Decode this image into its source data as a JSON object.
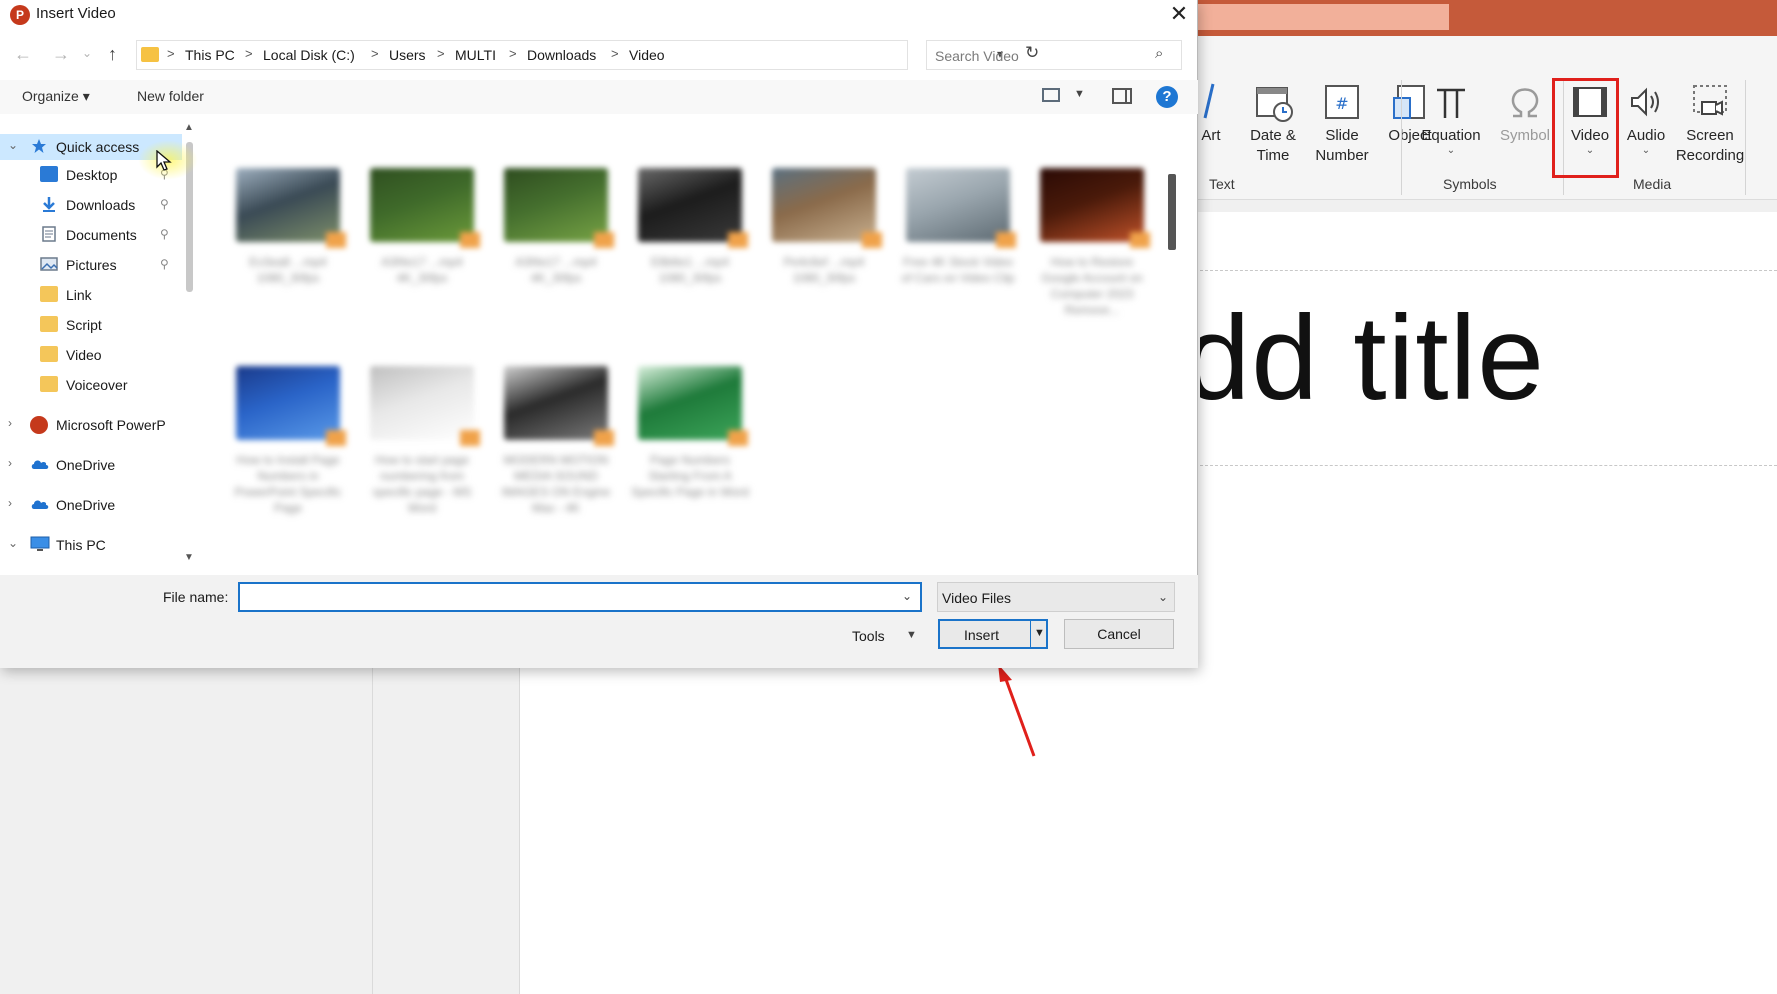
{
  "dialog": {
    "title": "Insert Video",
    "app_icon_letter": "P",
    "close_glyph": "✕"
  },
  "nav": {
    "back_glyph": "←",
    "forward_glyph": "→",
    "recent_glyph": "⌄",
    "up_glyph": "↑",
    "breadcrumb": [
      "This PC",
      "Local Disk (C:)",
      "Users",
      "MULTI",
      "Downloads",
      "Video"
    ],
    "crumb_sep": ">",
    "refresh_glyph": "↻",
    "search_placeholder": "Search Video",
    "search_glyph": "⌕"
  },
  "toolbar": {
    "organize_label": "Organize ▾",
    "new_folder_label": "New folder",
    "help_glyph": "?",
    "view_dd_glyph": "▼"
  },
  "sidebar": {
    "items": [
      {
        "label": "Quick access",
        "icon": "star-icon"
      },
      {
        "label": "Desktop",
        "icon": "desktop-icon"
      },
      {
        "label": "Downloads",
        "icon": "download-icon"
      },
      {
        "label": "Documents",
        "icon": "document-icon"
      },
      {
        "label": "Pictures",
        "icon": "pictures-icon"
      },
      {
        "label": "Link",
        "icon": "folder-icon"
      },
      {
        "label": "Script",
        "icon": "folder-icon"
      },
      {
        "label": "Video",
        "icon": "folder-icon"
      },
      {
        "label": "Voiceover",
        "icon": "folder-icon"
      },
      {
        "label": "Microsoft PowerP",
        "icon": "powerpoint-icon"
      },
      {
        "label": "OneDrive",
        "icon": "cloud-icon"
      },
      {
        "label": "OneDrive",
        "icon": "cloud-icon"
      },
      {
        "label": "This PC",
        "icon": "computer-icon"
      }
    ],
    "pin_glyph": "📌",
    "expand_glyph": "›",
    "collapse_glyph": "⌄"
  },
  "files": [
    {
      "caption": "Ev3ea8 ...mp4 1080_30fps",
      "colors": [
        "#3a4a55",
        "#7d8f6a",
        "#9fb0c0"
      ]
    },
    {
      "caption": "A3f4e17 ...mp4 4K_30fps",
      "colors": [
        "#3f6a2a",
        "#6b9a3a",
        "#2f4f20"
      ]
    },
    {
      "caption": "A3f4e17 ...mp4 4K_30fps",
      "colors": [
        "#456f2e",
        "#77a345",
        "#2e4c1f"
      ]
    },
    {
      "caption": "E8b6e1 ...mp4 1080_30fps",
      "colors": [
        "#1c1c1c",
        "#3a3a3a",
        "#6a6a6a"
      ]
    },
    {
      "caption": "Pe4c6ef ...mp4 1080_30fps",
      "colors": [
        "#8a6a4a",
        "#c8b090",
        "#5a7080"
      ]
    },
    {
      "caption": "Free 4K Stock Video of Cars on Video Clip",
      "colors": [
        "#9aa6ae",
        "#5d6a72",
        "#c4ccd2"
      ]
    },
    {
      "caption": "How to Restore Google Account on Computer 2023 Remove...",
      "colors": [
        "#4a1a0a",
        "#c0522a",
        "#2a0a05"
      ]
    },
    {
      "caption": "How to Install Page Numbers in PowerPoint Specific Page",
      "colors": [
        "#2a64c8",
        "#5a9ae8",
        "#1a3a8a"
      ]
    },
    {
      "caption": "How to start page numbering from specific page - MS Word",
      "colors": [
        "#e8e8e8",
        "#ffffff",
        "#bfbfbf"
      ]
    },
    {
      "caption": "MODERN MOTION MEDIA SOUND IMAGES ON Engine Max - 4K",
      "colors": [
        "#2a2a2a",
        "#7a7a7a",
        "#d0d0d0"
      ]
    },
    {
      "caption": "Page Numbers Starting From A Specific Page in Word",
      "colors": [
        "#1e7a3a",
        "#3da55a",
        "#d8f0dc"
      ]
    }
  ],
  "bottom": {
    "file_name_label": "File name:",
    "file_name_value": "",
    "filter_value": "Video Files",
    "tools_label": "Tools",
    "insert_label": "Insert",
    "cancel_label": "Cancel",
    "dd_glyph": "▾"
  },
  "ribbon": {
    "buttons": [
      {
        "label": "Art"
      },
      {
        "label": "Date &\nTime"
      },
      {
        "label": "Slide\nNumber"
      },
      {
        "label": "Object"
      },
      {
        "label": "Equation"
      },
      {
        "label": "Symbol"
      },
      {
        "label": "Video"
      },
      {
        "label": "Audio"
      },
      {
        "label": "Screen\nRecording"
      }
    ],
    "groups": [
      "Text",
      "Symbols",
      "Media"
    ]
  },
  "slide": {
    "title_placeholder": "Click to add title"
  },
  "colors": {
    "accent": "#1a73c9",
    "selection": "#cce8ff",
    "highlight_box": "#e0201b",
    "ppt_brand": "#c55a3a"
  }
}
